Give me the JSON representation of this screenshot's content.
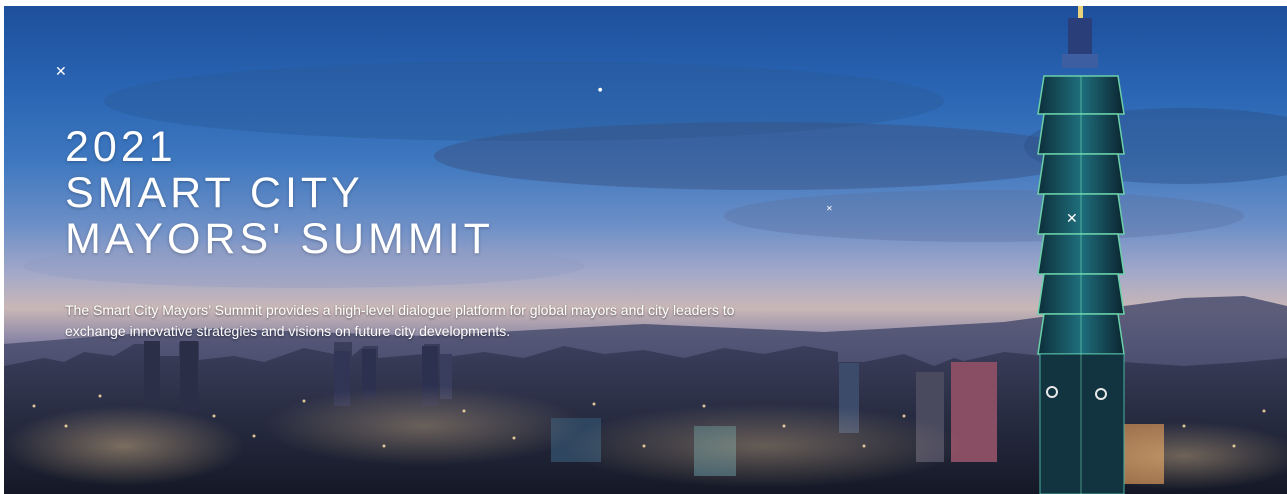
{
  "hero": {
    "title_lines": [
      "2021",
      "SMART CITY",
      "MAYORS' SUMMIT"
    ],
    "description": "The Smart City Mayors’ Summit provides a high-level dialogue platform for global mayors and city leaders to exchange innovative strategies and visions on future city developments."
  },
  "icons": {
    "sparkle": "sparkle-icon"
  },
  "colors": {
    "sky_top": "#1d4f9c",
    "sky_horizon": "#c9b7b6",
    "city": "#1f2238",
    "text": "#ffffff"
  }
}
